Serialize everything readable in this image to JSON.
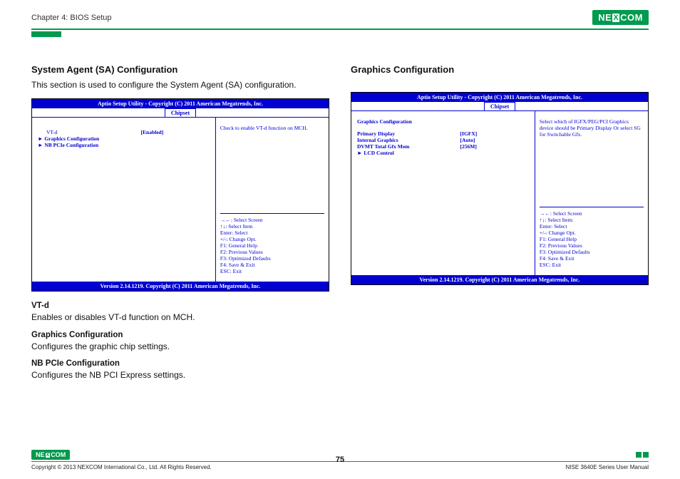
{
  "header": {
    "chapter": "Chapter 4: BIOS Setup",
    "logo_text_left": "NE",
    "logo_text_x": "X",
    "logo_text_right": "COM"
  },
  "left": {
    "title": "System Agent (SA) Configuration",
    "desc": "This section is used to configure the System Agent (SA) configuration.",
    "bios": {
      "header": "Aptio Setup Utility - Copyright (C) 2011 American Megatrends, Inc.",
      "tab": "Chipset",
      "rows": [
        {
          "label": "VT-d",
          "value": "[Enabled]",
          "arrow": false
        },
        {
          "label": "Graphics Configuration",
          "value": "",
          "arrow": true
        },
        {
          "label": "NB PCIe Configuration",
          "value": "",
          "arrow": true
        }
      ],
      "help_top": "Check to enable VT-d function on MCH.",
      "help_keys": [
        "→←: Select Screen",
        "↑↓: Select Item",
        "Enter: Select",
        "+/-: Change Opt.",
        "F1: General Help",
        "F2: Previous Values",
        "F3: Optimized Defaults",
        "F4: Save & Exit",
        "ESC: Exit"
      ],
      "footer": "Version 2.14.1219. Copyright (C) 2011 American Megatrends, Inc."
    },
    "subs": [
      {
        "title": "VT-d",
        "desc": "Enables or disables VT-d function on MCH."
      },
      {
        "title": "Graphics Configuration",
        "desc": "Configures the graphic chip settings."
      },
      {
        "title": "NB PCIe Configuration",
        "desc": "Configures the NB PCI Express settings."
      }
    ]
  },
  "right": {
    "title": "Graphics Configuration",
    "bios": {
      "header": "Aptio Setup Utility - Copyright (C) 2011 American Megatrends, Inc.",
      "tab": "Chipset",
      "section_heading": "Graphics Configuration",
      "rows": [
        {
          "label": "Primary Display",
          "value": "[IGFX]",
          "arrow": false
        },
        {
          "label": "Internal Graphics",
          "value": "[Auto]",
          "arrow": false
        },
        {
          "label": "DVMT Total Gfx Mem",
          "value": "[256M]",
          "arrow": false
        },
        {
          "label": "LCD Control",
          "value": "",
          "arrow": true
        }
      ],
      "help_top": "Select which of IGFX/PEG/PCI Graphics device should be Primary Display Or select SG for Switchable Gfx.",
      "help_keys": [
        "→←: Select Screen",
        "↑↓: Select Item:",
        "Enter: Select",
        "+/-: Change Opt.",
        "F1: General Help",
        "F2: Previous Values",
        "F3: Optimized Defaults",
        "F4: Save & Exit",
        "ESC: Exit"
      ],
      "footer": "Version 2.14.1219. Copyright (C) 2011 American Megatrends, Inc."
    }
  },
  "footer": {
    "copyright": "Copyright © 2013 NEXCOM International Co., Ltd. All Rights Reserved.",
    "page": "75",
    "manual": "NISE 3640E Series User Manual"
  }
}
